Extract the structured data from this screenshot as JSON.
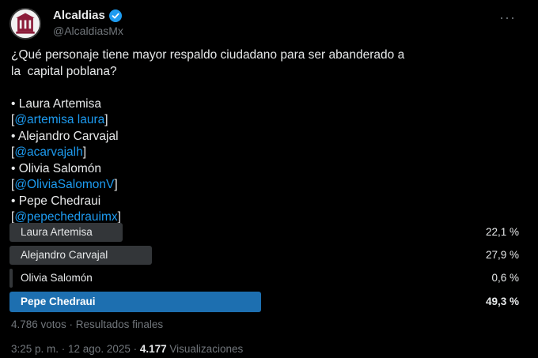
{
  "author": {
    "display_name": "Alcaldias",
    "handle": "@AlcaldiasMx",
    "avatar_icon": "building-icon",
    "verified_icon": "verified-badge-icon"
  },
  "more_icon": "more-dots-icon",
  "more_glyph": "···",
  "post": {
    "question_line1": "¿Qué personaje tiene mayor respaldo ciudadano para ser abanderado a",
    "question_line2": "la  capital poblana?",
    "candidates": [
      {
        "name": "• Laura Artemisa",
        "open": "[",
        "mention": "@artemisa laura",
        "close": "]"
      },
      {
        "name": "• Alejandro Carvajal",
        "open": "[",
        "mention": "@acarvajalh",
        "close": "]"
      },
      {
        "name": "• Olivia Salomón",
        "open": "[",
        "mention": "@OliviaSalomonV",
        "close": "]"
      },
      {
        "name": "• Pepe Chedraui",
        "open": "[",
        "mention": "@pepechedrauimx",
        "close": "]"
      }
    ]
  },
  "poll": {
    "options": [
      {
        "label": "Laura Artemisa",
        "percent_text": "22,1 %",
        "percent": 22.1
      },
      {
        "label": "Alejandro Carvajal",
        "percent_text": "27,9 %",
        "percent": 27.9
      },
      {
        "label": "Olivia Salomón",
        "percent_text": "0,6 %",
        "percent": 0.6
      },
      {
        "label": "Pepe Chedraui",
        "percent_text": "49,3 %",
        "percent": 49.3
      }
    ],
    "votes_text": "4.786 votos · Resultados finales"
  },
  "meta": {
    "time_date": "3:25 p. m. · 12 ago. 2025 · ",
    "views_count": "4.177",
    "views_label": " Visualizaciones"
  },
  "colors": {
    "background": "#000000",
    "text": "#e7e9ea",
    "muted": "#71767b",
    "link": "#1d9bf0",
    "poll_bar": "#333639",
    "poll_winner_bar": "#1d6fb0"
  }
}
